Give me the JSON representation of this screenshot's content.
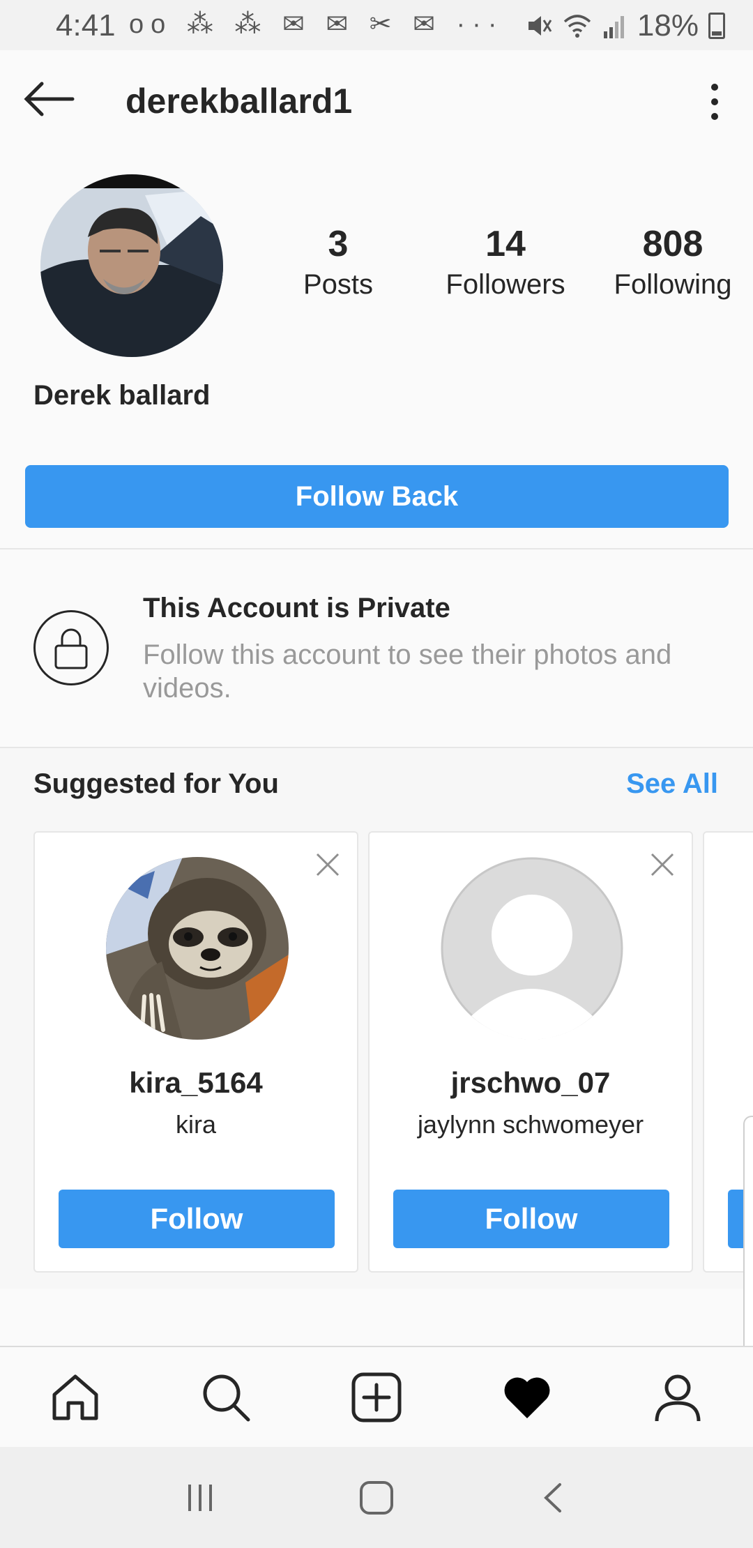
{
  "status_bar": {
    "time": "4:41",
    "left_icons": "oo ⁂ ⁂ ✉ ✉ ✂ ✉ ···",
    "battery_percent": "18%"
  },
  "header": {
    "username": "derekballard1",
    "back_icon": "arrow-left-icon",
    "menu_icon": "kebab-menu-icon"
  },
  "profile": {
    "full_name": "Derek ballard",
    "stats": [
      {
        "value": "3",
        "label": "Posts"
      },
      {
        "value": "14",
        "label": "Followers"
      },
      {
        "value": "808",
        "label": "Following"
      }
    ],
    "follow_back_label": "Follow Back"
  },
  "private_notice": {
    "title": "This Account is Private",
    "subtitle": "Follow this account to see their photos and videos."
  },
  "suggested": {
    "title": "Suggested for You",
    "see_all": "See All",
    "cards": [
      {
        "username": "kira_5164",
        "name": "kira",
        "button": "Follow"
      },
      {
        "username": "jrschwo_07",
        "name": "jaylynn schwomeyer",
        "button": "Follow"
      }
    ]
  },
  "bottom_nav": [
    "home-icon",
    "search-icon",
    "add-post-icon",
    "activity-heart-icon",
    "profile-icon"
  ],
  "system_nav": [
    "recent-apps-icon",
    "home-button-icon",
    "back-icon"
  ],
  "colors": {
    "accent": "#3897f0",
    "text": "#262626",
    "muted": "#999999"
  }
}
